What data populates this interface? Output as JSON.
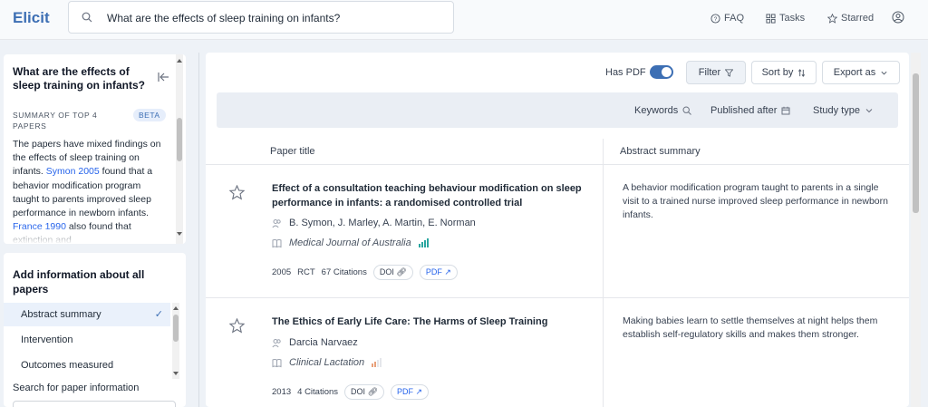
{
  "app": {
    "name": "Elicit"
  },
  "search": {
    "query": "What are the effects of sleep training on infants?"
  },
  "nav": {
    "faq": "FAQ",
    "tasks": "Tasks",
    "starred": "Starred"
  },
  "sidebar": {
    "question": "What are the effects of sleep training on infants?",
    "summary_label": "SUMMARY OF TOP 4 PAPERS",
    "beta": "BETA",
    "summary_part1": "The papers have mixed findings on the effects of sleep training on infants.",
    "summary_ref1": "Symon 2005",
    "summary_part2": "found that a behavior modification program taught to parents improved sleep performance in newborn infants.",
    "summary_ref2": "France 1990",
    "summary_part3": "also found that extinction and",
    "add_info_title": "Add information about all papers",
    "options": [
      "Abstract summary",
      "Intervention",
      "Outcomes measured"
    ],
    "selected_option": "Abstract summary",
    "search_info_label": "Search for paper information"
  },
  "toolbar": {
    "has_pdf_label": "Has PDF",
    "has_pdf_on": true,
    "filter_label": "Filter",
    "sort_label": "Sort by",
    "export_label": "Export as"
  },
  "filters": {
    "keywords": "Keywords",
    "published_after": "Published after",
    "study_type": "Study type"
  },
  "table": {
    "col_title": "Paper title",
    "col_abstract": "Abstract summary",
    "rows": [
      {
        "title": "Effect of a consultation teaching behaviour modification on sleep performance in infants: a randomised controlled trial",
        "authors": "B. Symon, J. Marley, A. Martin, E. Norman",
        "journal": "Medical Journal of Australia",
        "journal_bar_color": "#2aa6a0",
        "journal_quality_bars": 4,
        "year": "2005",
        "study_type": "RCT",
        "citations": "67 Citations",
        "doi": "DOI",
        "pdf": "PDF",
        "abstract": "A behavior modification program taught to parents in a single visit to a trained nurse improved sleep performance in newborn infants."
      },
      {
        "title": "The Ethics of Early Life Care: The Harms of Sleep Training",
        "authors": "Darcia Narvaez",
        "journal": "Clinical Lactation",
        "journal_bar_color": "#e8a07a",
        "journal_quality_bars": 2,
        "year": "2013",
        "study_type": "",
        "citations": "4 Citations",
        "doi": "DOI",
        "pdf": "PDF",
        "abstract": "Making babies learn to settle themselves at night helps them establish self-regulatory skills and makes them stronger."
      }
    ]
  }
}
